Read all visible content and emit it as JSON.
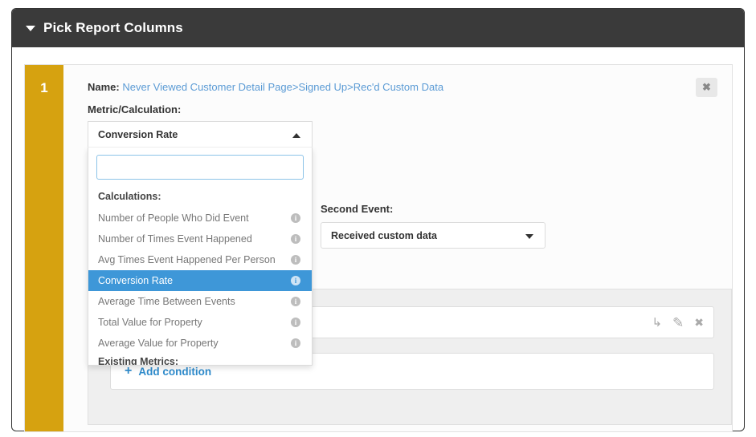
{
  "panel": {
    "title": "Pick Report Columns",
    "collapse_icon": "caret-down-icon"
  },
  "card": {
    "index": "1",
    "close_label": "✖",
    "name_label": "Name:",
    "name_value": "Never Viewed Customer Detail Page>Signed Up>Rec'd Custom Data",
    "metric_label": "Metric/Calculation:"
  },
  "metric_combo": {
    "selected": "Conversion Rate",
    "search_value": "",
    "search_placeholder": "",
    "caret_icon": "caret-up-icon",
    "groups": [
      {
        "label": "Calculations:",
        "options": [
          {
            "label": "Number of People Who Did Event",
            "selected": false,
            "info": "i"
          },
          {
            "label": "Number of Times Event Happened",
            "selected": false,
            "info": "i"
          },
          {
            "label": "Avg Times Event Happened Per Person",
            "selected": false,
            "info": "i"
          },
          {
            "label": "Conversion Rate",
            "selected": true,
            "info": "i"
          },
          {
            "label": "Average Time Between Events",
            "selected": false,
            "info": "i"
          },
          {
            "label": "Total Value for Property",
            "selected": false,
            "info": "i"
          },
          {
            "label": "Average Value for Property",
            "selected": false,
            "info": "i"
          }
        ]
      },
      {
        "label": "Existing Metrics:",
        "options": []
      }
    ]
  },
  "second_event": {
    "label": "Second Event:",
    "value": "Received custom data",
    "caret_icon": "caret-down-icon"
  },
  "filters": {
    "condition_text": "",
    "actions": [
      {
        "name": "move-icon",
        "glyph": "↳"
      },
      {
        "name": "edit-pencil-icon",
        "glyph": "✎"
      },
      {
        "name": "delete-x-icon",
        "glyph": "✖"
      }
    ],
    "add_condition_label": "Add condition",
    "add_icon": "plus-icon"
  },
  "colors": {
    "header_bg": "#3a3a3a",
    "index_bar": "#d6a210",
    "selection_blue": "#3e97d8",
    "link_blue": "#5b9bd5",
    "action_blue": "#2e8bcc"
  }
}
